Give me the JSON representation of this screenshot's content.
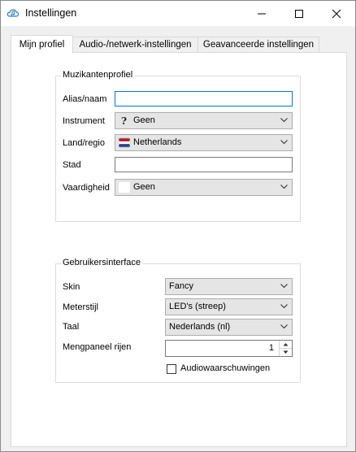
{
  "window": {
    "title": "Instellingen",
    "icons": {
      "app": "cloud-music-icon",
      "minimize": "minimize-icon",
      "maximize": "maximize-icon",
      "close": "close-icon"
    }
  },
  "tabs": [
    {
      "label": "Mijn profiel",
      "active": true
    },
    {
      "label": "Audio-/netwerk-instellingen",
      "active": false
    },
    {
      "label": "Geavanceerde instellingen",
      "active": false
    }
  ],
  "profile": {
    "group_title": "Muzikantenprofiel",
    "alias_label": "Alias/naam",
    "alias_value": "",
    "instrument_label": "Instrument",
    "instrument_value": "Geen",
    "instrument_icon": "question-mark-icon",
    "country_label": "Land/regio",
    "country_value": "Netherlands",
    "country_icon": "netherlands-flag-icon",
    "city_label": "Stad",
    "city_value": "",
    "skill_label": "Vaardigheid",
    "skill_value": "Geen",
    "skill_icon": "blank-swatch-icon"
  },
  "ui": {
    "group_title": "Gebruikersinterface",
    "skin_label": "Skin",
    "skin_value": "Fancy",
    "meter_label": "Meterstijl",
    "meter_value": "LED's (streep)",
    "language_label": "Taal",
    "language_value": "Nederlands (nl)",
    "mixer_rows_label": "Mengpaneel rijen",
    "mixer_rows_value": "1",
    "audio_alerts_label": "Audiowaarschuwingen",
    "audio_alerts_checked": false
  },
  "colors": {
    "focus_border": "#0078d7",
    "flag_red": "#ae1c28",
    "flag_white": "#ffffff",
    "flag_blue": "#21468b"
  }
}
